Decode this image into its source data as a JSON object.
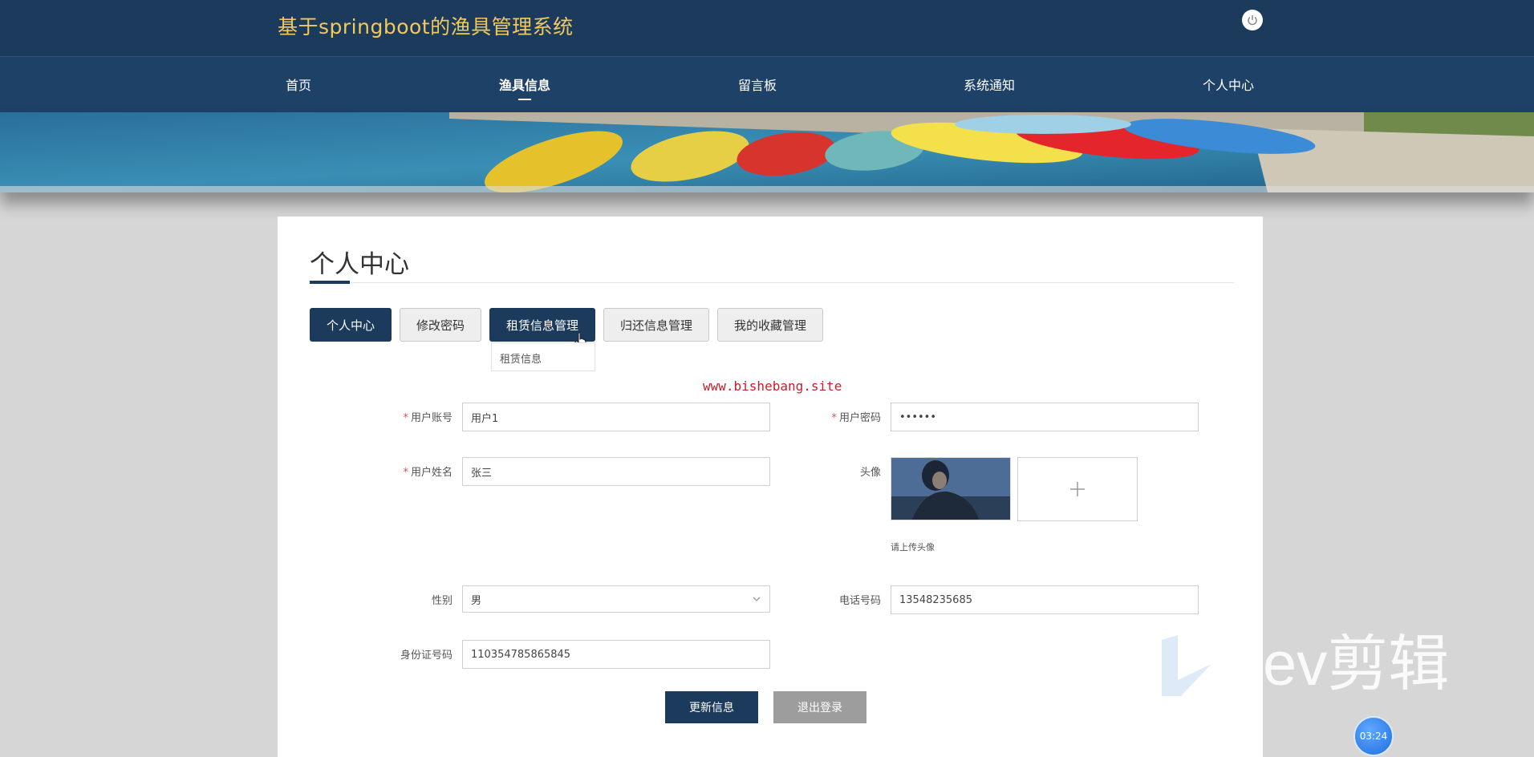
{
  "header": {
    "site_title": "基于springboot的渔具管理系统",
    "power_icon": "power-icon"
  },
  "nav": {
    "items": [
      "首页",
      "渔具信息",
      "留言板",
      "系统通知",
      "个人中心"
    ],
    "active": "渔具信息"
  },
  "page": {
    "title": "个人中心",
    "tabs": [
      "个人中心",
      "修改密码",
      "租赁信息管理",
      "归还信息管理",
      "我的收藏管理"
    ],
    "active_tabs": [
      "个人中心",
      "租赁信息管理"
    ],
    "dropdown_item": "租赁信息",
    "watermark": "www.bishebang.site"
  },
  "form": {
    "account_label": "用户账号",
    "account_value": "用户1",
    "password_label": "用户密码",
    "password_value": "••••••",
    "name_label": "用户姓名",
    "name_value": "张三",
    "avatar_label": "头像",
    "avatar_hint": "请上传头像",
    "gender_label": "性别",
    "gender_value": "男",
    "phone_label": "电话号码",
    "phone_value": "13548235685",
    "id_label": "身份证号码",
    "id_value": "110354785865845",
    "update_button": "更新信息",
    "logout_button": "退出登录"
  },
  "overlay": {
    "editor_logo_text": "ev剪辑",
    "timer": "03:24"
  },
  "colors": {
    "header_bg": "#1b3a5c",
    "title_color": "#f1c95c",
    "accent": "#1b3a5c",
    "required": "#e0504c",
    "watermark": "#c8202a"
  }
}
